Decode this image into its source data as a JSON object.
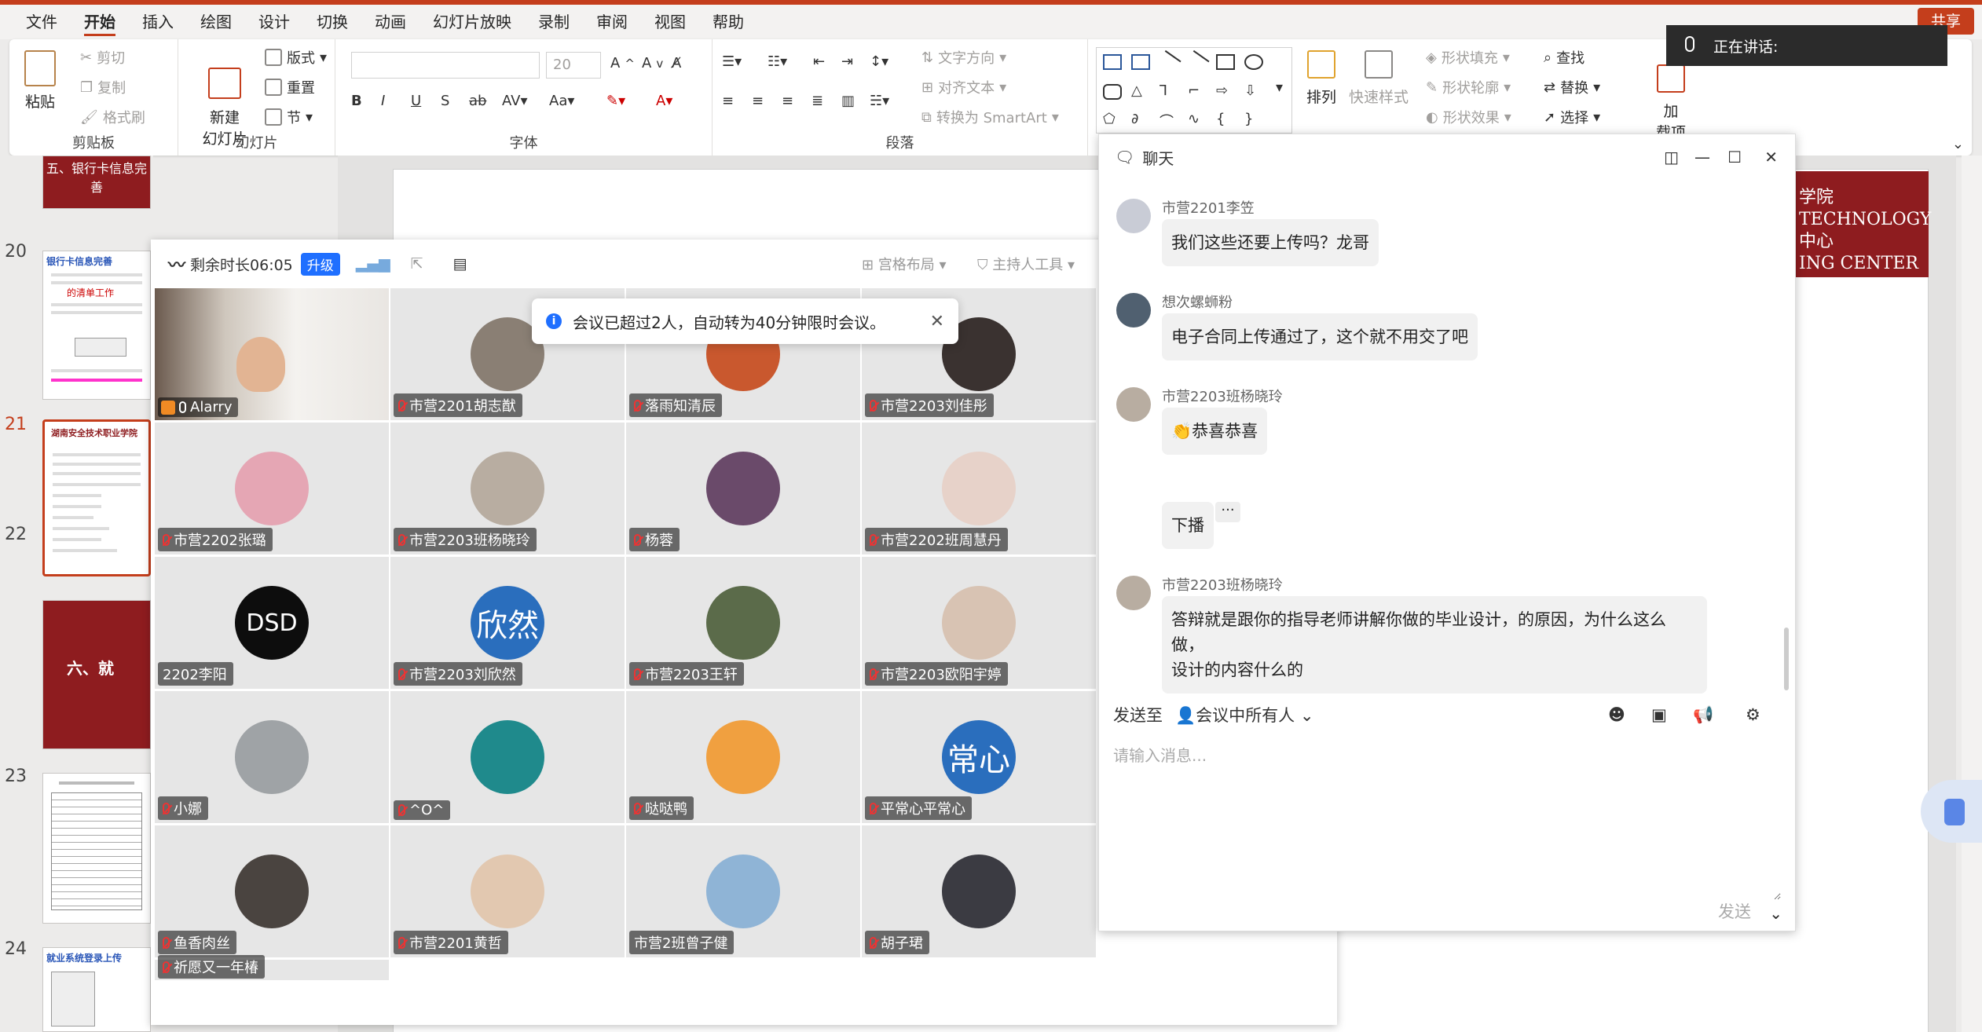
{
  "menu": {
    "tabs": [
      "文件",
      "开始",
      "插入",
      "绘图",
      "设计",
      "切换",
      "动画",
      "幻灯片放映",
      "录制",
      "审阅",
      "视图",
      "帮助"
    ],
    "active": "开始",
    "share": "共享"
  },
  "ribbon": {
    "clipboard": {
      "label": "剪贴板",
      "paste": "粘贴",
      "cut": "剪切",
      "copy": "复制",
      "format_painter": "格式刷"
    },
    "slides": {
      "label": "幻灯片",
      "new_slide": "新建\n幻灯片",
      "layout": "版式",
      "reset": "重置",
      "section": "节"
    },
    "font": {
      "label": "字体",
      "size": "20"
    },
    "paragraph": {
      "label": "段落",
      "text_direction": "文字方向",
      "align_text": "对齐文本",
      "smartart": "转换为 SmartArt"
    },
    "drawing": {
      "arrange": "排列",
      "quick_styles": "快速样式",
      "shape_fill": "形状填充",
      "shape_outline": "形状轮廓",
      "shape_effects": "形状效果"
    },
    "editing": {
      "find": "查找",
      "replace": "替换",
      "select": "选择"
    },
    "addins": {
      "label": "加\n载项"
    }
  },
  "speaking": {
    "label": "正在讲话:"
  },
  "slides_panel": {
    "numbers": [
      "20",
      "21",
      "22",
      "23",
      "24"
    ],
    "active": "21",
    "thumbs": {
      "s19_title": "五、银行卡信息完善",
      "s20_title": "银行卡信息完善",
      "s20_red": "的清单工作",
      "s21_title": "湖南安全技术职业学院",
      "s22_title": "六、就",
      "s24_title": "就业系统登录上传"
    }
  },
  "slide": {
    "deco": "学院\nTECHNOLOGY\n中心\nING CENTER"
  },
  "meeting": {
    "remaining": "剩余时长06:05",
    "upgrade": "升级",
    "grid_layout": "宫格布局",
    "host_tools": "主持人工具",
    "toast": "会议已超过2人，自动转为40分钟限时会议。",
    "participants": [
      {
        "name": "Alarry",
        "avatar": "photo-room",
        "color": "#d8d2cb"
      },
      {
        "name": "市营2201胡志猷",
        "avatar": "photo-bag",
        "color": "#8a7f74"
      },
      {
        "name": "落雨知清辰",
        "avatar": "photo-sunset",
        "color": "#c9582e"
      },
      {
        "name": "市营2203刘佳彤",
        "avatar": "photo-girl",
        "color": "#3a3230"
      },
      {
        "name": "市营2202张璐",
        "avatar": "cartoon-panda",
        "color": "#e5a6b4"
      },
      {
        "name": "市营2203班杨晓玲",
        "avatar": "photo-cat",
        "color": "#b8ada1"
      },
      {
        "name": "杨蓉",
        "avatar": "photo-kid",
        "color": "#6a4a6a"
      },
      {
        "name": "市营2202班周慧丹",
        "avatar": "photo-woman",
        "color": "#e7d2c9"
      },
      {
        "name": "2202李阳",
        "avatar": "logo-dsd",
        "color": "#0d0d0d",
        "text": "DSD"
      },
      {
        "name": "市营2203刘欣然",
        "avatar": "text-avatar",
        "color": "#2a6ebd",
        "text": "欣然"
      },
      {
        "name": "市营2203王轩",
        "avatar": "photo-boy",
        "color": "#5b6b4a"
      },
      {
        "name": "市营2203欧阳宇婷",
        "avatar": "photo-cat-girl",
        "color": "#d8c3b3"
      },
      {
        "name": "小娜",
        "avatar": "photo-cap",
        "color": "#9fa3a6"
      },
      {
        "name": "^O^",
        "avatar": "photo-teal",
        "color": "#1f8a8c"
      },
      {
        "name": "哒哒鸭",
        "avatar": "cartoon-boy",
        "color": "#f0a040"
      },
      {
        "name": "平常心平常心",
        "avatar": "text-avatar",
        "color": "#2a6ebd",
        "text": "常心"
      },
      {
        "name": "鱼香肉丝",
        "avatar": "photo-hat",
        "color": "#4a4440"
      },
      {
        "name": "市营2201黄哲",
        "avatar": "photo-blonde",
        "color": "#e2c8b0"
      },
      {
        "name": "市营2班曾子健",
        "avatar": "photo-sky",
        "color": "#8fb4d6"
      },
      {
        "name": "胡子珺",
        "avatar": "photo-anime",
        "color": "#3b3b42"
      },
      {
        "name": "祈愿又一年椿",
        "avatar": "none",
        "color": "#e6e6e6"
      }
    ]
  },
  "chat": {
    "title": "聊天",
    "messages": [
      {
        "name": "市营2201李笠",
        "text": "我们这些还要上传吗？龙哥"
      },
      {
        "name": "想次螺蛳粉",
        "text": "电子合同上传通过了，这个就不用交了吧"
      },
      {
        "name": "市营2203班杨晓玲",
        "text": "恭喜恭喜"
      },
      {
        "name": "",
        "text": "下播"
      },
      {
        "name": "市营2203班杨晓玲",
        "text": "答辩就是跟你的指导老师讲解你做的毕业设计，的原因，为什么这么做，\n设计的内容什么的"
      }
    ],
    "send_to_label": "发送至",
    "send_to_value": "会议中所有人",
    "placeholder": "请输入消息...",
    "send": "发送"
  }
}
